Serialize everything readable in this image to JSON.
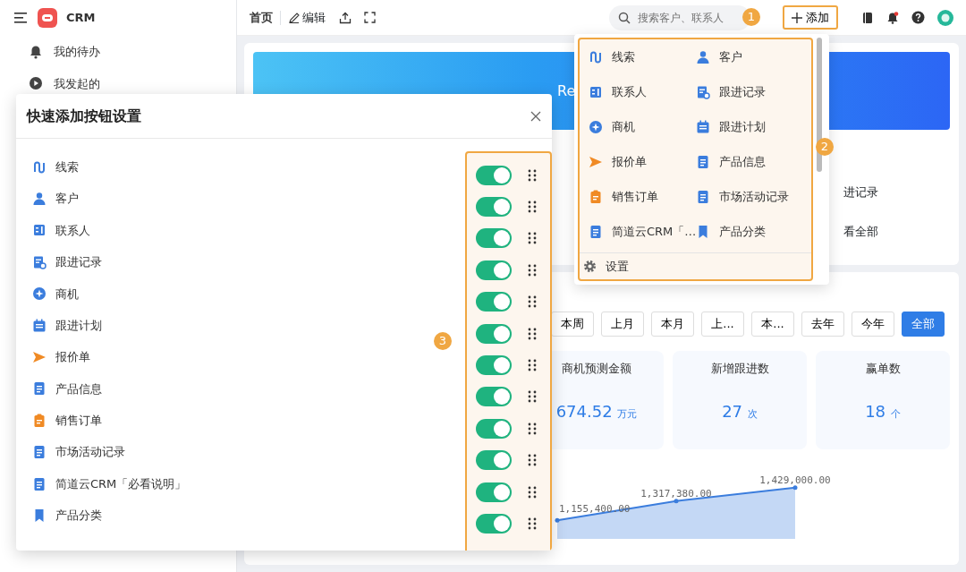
{
  "sidebar": {
    "app_name": "CRM",
    "items": [
      {
        "label": "我的待办",
        "kind": "bell"
      },
      {
        "label": "我发起的",
        "kind": "play"
      }
    ]
  },
  "toolbar": {
    "home_tab": "首页",
    "edit_button": "编辑",
    "search": {
      "placeholder": "搜索客户、联系人"
    },
    "add_button": "添加"
  },
  "banner": {
    "text": "Re"
  },
  "summary_links": [
    "进记录",
    "看全部"
  ],
  "add_menu": {
    "items": [
      {
        "label": "线索",
        "kind": "route"
      },
      {
        "label": "客户",
        "kind": "person"
      },
      {
        "label": "联系人",
        "kind": "contact"
      },
      {
        "label": "跟进记录",
        "kind": "record"
      },
      {
        "label": "商机",
        "kind": "compass"
      },
      {
        "label": "跟进计划",
        "kind": "plan"
      },
      {
        "label": "报价单",
        "kind": "send"
      },
      {
        "label": "产品信息",
        "kind": "doc"
      },
      {
        "label": "销售订单",
        "kind": "clipboard"
      },
      {
        "label": "市场活动记录",
        "kind": "doc"
      },
      {
        "label": "简道云CRM「…",
        "kind": "doc"
      },
      {
        "label": "产品分类",
        "kind": "bookmark"
      }
    ],
    "settings_label": "设置"
  },
  "callouts": [
    "1",
    "2",
    "3"
  ],
  "filters": [
    {
      "label": "本周",
      "selected": false
    },
    {
      "label": "上月",
      "selected": false
    },
    {
      "label": "本月",
      "selected": false
    },
    {
      "label": "上...",
      "selected": false
    },
    {
      "label": "本...",
      "selected": false
    },
    {
      "label": "去年",
      "selected": false
    },
    {
      "label": "今年",
      "selected": false
    },
    {
      "label": "全部",
      "selected": true
    }
  ],
  "stats": [
    {
      "title": "商机预测金额",
      "value": "674.52",
      "unit": "万元"
    },
    {
      "title": "新增跟进数",
      "value": "27",
      "unit": "次"
    },
    {
      "title": "赢单数",
      "value": "18",
      "unit": "个"
    }
  ],
  "trend": {
    "point_labels": [
      "1,155,400.00",
      "1,317,380.00",
      "1,429,000.00"
    ]
  },
  "modal": {
    "title": "快速添加按钮设置",
    "items": [
      {
        "label": "线索",
        "kind": "route",
        "on": true
      },
      {
        "label": "客户",
        "kind": "person",
        "on": true
      },
      {
        "label": "联系人",
        "kind": "contact",
        "on": true
      },
      {
        "label": "跟进记录",
        "kind": "record",
        "on": true
      },
      {
        "label": "商机",
        "kind": "compass",
        "on": true
      },
      {
        "label": "跟进计划",
        "kind": "plan",
        "on": true
      },
      {
        "label": "报价单",
        "kind": "send",
        "on": true
      },
      {
        "label": "产品信息",
        "kind": "doc",
        "on": true
      },
      {
        "label": "销售订单",
        "kind": "clipboard",
        "on": true
      },
      {
        "label": "市场活动记录",
        "kind": "doc",
        "on": true
      },
      {
        "label": "简道云CRM「必看说明」",
        "kind": "doc",
        "on": true
      },
      {
        "label": "产品分类",
        "kind": "bookmark",
        "on": true
      }
    ]
  }
}
